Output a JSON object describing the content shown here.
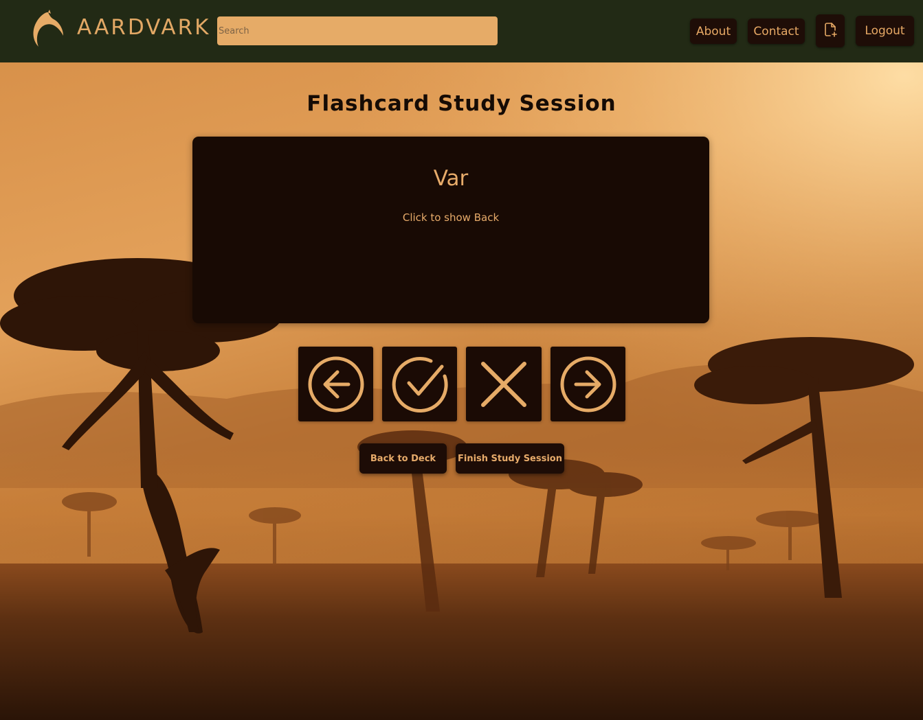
{
  "app": {
    "brand": "AARDVARK",
    "colors": {
      "navbar": "#222a15",
      "accent": "#e6ab67",
      "dark_button": "#1b0b05",
      "sky_top": "#f5c488",
      "ground": "#2a1608"
    }
  },
  "navbar": {
    "search_placeholder": "Search",
    "about_label": "About",
    "contact_label": "Contact",
    "new_file_icon": "file-plus-icon",
    "logout_label": "Logout"
  },
  "main": {
    "title": "Flashcard Study Session",
    "card": {
      "term": "Var",
      "hint": "Click to show Back"
    },
    "controls": [
      {
        "name": "previous",
        "icon": "arrow-left-circle-icon"
      },
      {
        "name": "correct",
        "icon": "check-circle-icon"
      },
      {
        "name": "incorrect",
        "icon": "x-icon"
      },
      {
        "name": "next",
        "icon": "arrow-right-circle-icon"
      }
    ],
    "back_to_deck_label": "Back to Deck",
    "finish_label": "Finish Study Session"
  }
}
